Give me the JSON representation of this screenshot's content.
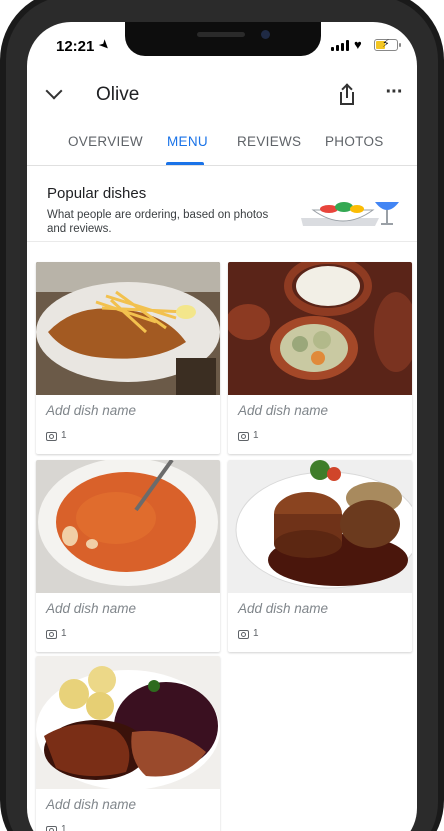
{
  "status_bar": {
    "time": "12:21"
  },
  "header": {
    "title": "Olive"
  },
  "tabs": [
    {
      "label": "OVERVIEW",
      "active": false
    },
    {
      "label": "MENU",
      "active": true
    },
    {
      "label": "REVIEWS",
      "active": false
    },
    {
      "label": "PHOTOS",
      "active": false
    }
  ],
  "popular": {
    "title": "Popular dishes",
    "subtitle": "What people are ordering, based on photos and reviews."
  },
  "dishes": [
    {
      "name_placeholder": "Add dish name",
      "photo_count": "1",
      "photo": "schnitzel-with-fries"
    },
    {
      "name_placeholder": "Add dish name",
      "photo_count": "1",
      "photo": "stuffed-cabbage-in-clay-pots"
    },
    {
      "name_placeholder": "Add dish name",
      "photo_count": "1",
      "photo": "tomato-soup"
    },
    {
      "name_placeholder": "Add dish name",
      "photo_count": "1",
      "photo": "steak-with-sauce"
    },
    {
      "name_placeholder": "Add dish name",
      "photo_count": "1",
      "photo": "duck-with-dumplings-and-red-cabbage"
    }
  ],
  "colors": {
    "accent": "#1a73e8",
    "text_primary": "#202124",
    "text_secondary": "#5f6368"
  }
}
